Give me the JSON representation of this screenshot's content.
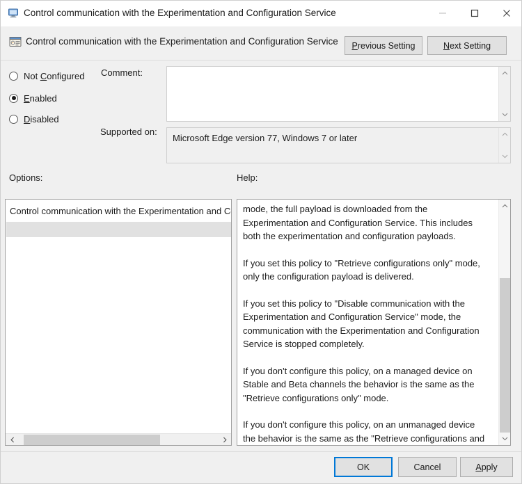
{
  "window": {
    "title": "Control communication with the Experimentation and Configuration Service",
    "title_icon": "computer-monitor-icon",
    "minimize_label": "—",
    "maximize_label": "□",
    "close_label": "✕"
  },
  "header": {
    "policy_icon": "policy-setting-icon",
    "policy_title": "Control communication with the Experimentation and Configuration Service",
    "previous_setting": {
      "pre": "P",
      "post": "revious Setting"
    },
    "next_setting": {
      "pre": "N",
      "post": "ext Setting"
    }
  },
  "state": {
    "options": [
      {
        "pre": "Not ",
        "key": "C",
        "post": "onfigured",
        "selected": false
      },
      {
        "pre": "",
        "key": "E",
        "post": "nabled",
        "selected": true
      },
      {
        "pre": "",
        "key": "D",
        "post": "isabled",
        "selected": false
      }
    ],
    "selected_value": "Enabled"
  },
  "comment": {
    "label": "Comment:",
    "value": "",
    "placeholder": ""
  },
  "supported_on": {
    "label": "Supported on:",
    "value": "Microsoft Edge version 77, Windows 7 or later"
  },
  "options_panel": {
    "label": "Options:",
    "setting_label": "Control communication with the Experimentation and Configuration Service",
    "scroll_left_icon": "chevron-left-icon",
    "scroll_right_icon": "chevron-right-icon"
  },
  "help_panel": {
    "label": "Help:",
    "scroll_up_icon": "chevron-up-icon",
    "scroll_down_icon": "chevron-down-icon",
    "paragraphs": [
      "mode, the full payload is downloaded from the Experimentation and Configuration Service. This includes both the experimentation and configuration payloads.",
      "If you set this policy to \"Retrieve configurations only\" mode, only the configuration payload is delivered.",
      "If you set this policy to \"Disable communication with the Experimentation and Configuration Service\" mode, the communication with the Experimentation and Configuration Service is stopped completely.",
      "If you don't configure this policy, on a managed device on Stable and Beta channels the behavior is the same as the \"Retrieve configurations only\" mode.",
      "If you don't configure this policy, on an unmanaged device the behavior is the same as the \"Retrieve configurations and experiments\" mode."
    ]
  },
  "footer": {
    "ok": "OK",
    "cancel": "Cancel",
    "apply": {
      "pre": "A",
      "post": "pply"
    }
  },
  "colors": {
    "window_background": "#f0f0f0",
    "titlebar_background": "#ffffff",
    "field_background": "#ffffff",
    "button_face": "#e1e1e1",
    "button_border": "#adadad",
    "focus_accent": "#0078d7",
    "text": "#1b1b1b",
    "scroll_thumb": "#cdcdcd"
  }
}
